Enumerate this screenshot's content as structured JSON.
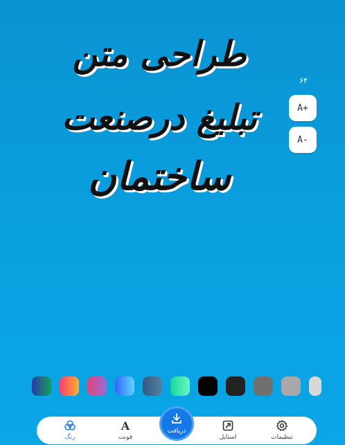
{
  "headline": {
    "line1": "طراحی متن",
    "line2": "تبلیغ درصنعت",
    "line3": "ساختمان"
  },
  "font_size": {
    "value": "۶۴",
    "increase_label": "A+",
    "decrease_label": "A-"
  },
  "swatches": [
    {
      "from": "#2a3aa8",
      "to": "#14a05a"
    },
    {
      "from": "#ff3d6e",
      "to": "#ffb030"
    },
    {
      "from": "#e0457a",
      "to": "#9b6ad9"
    },
    {
      "from": "#2d6bff",
      "to": "#63d2ff"
    },
    {
      "from": "#2e5a86",
      "to": "#5a7e9c"
    },
    {
      "from": "#16d89a",
      "to": "#6cf5c5"
    },
    {
      "from": "#000000",
      "to": "#000000"
    },
    {
      "from": "#222222",
      "to": "#222222"
    },
    {
      "from": "#707070",
      "to": "#707070"
    },
    {
      "from": "#a8a8a8",
      "to": "#a8a8a8"
    },
    {
      "from": "#d8d8d8",
      "to": "#d8d8d8"
    }
  ],
  "nav": {
    "color_label": "رنگ",
    "font_label": "فونت",
    "download_label": "دریافت",
    "style_label": "استایل",
    "settings_label": "تنظیمات"
  },
  "colors": {
    "accent": "#1578e6",
    "background": "#0aa0e0"
  }
}
